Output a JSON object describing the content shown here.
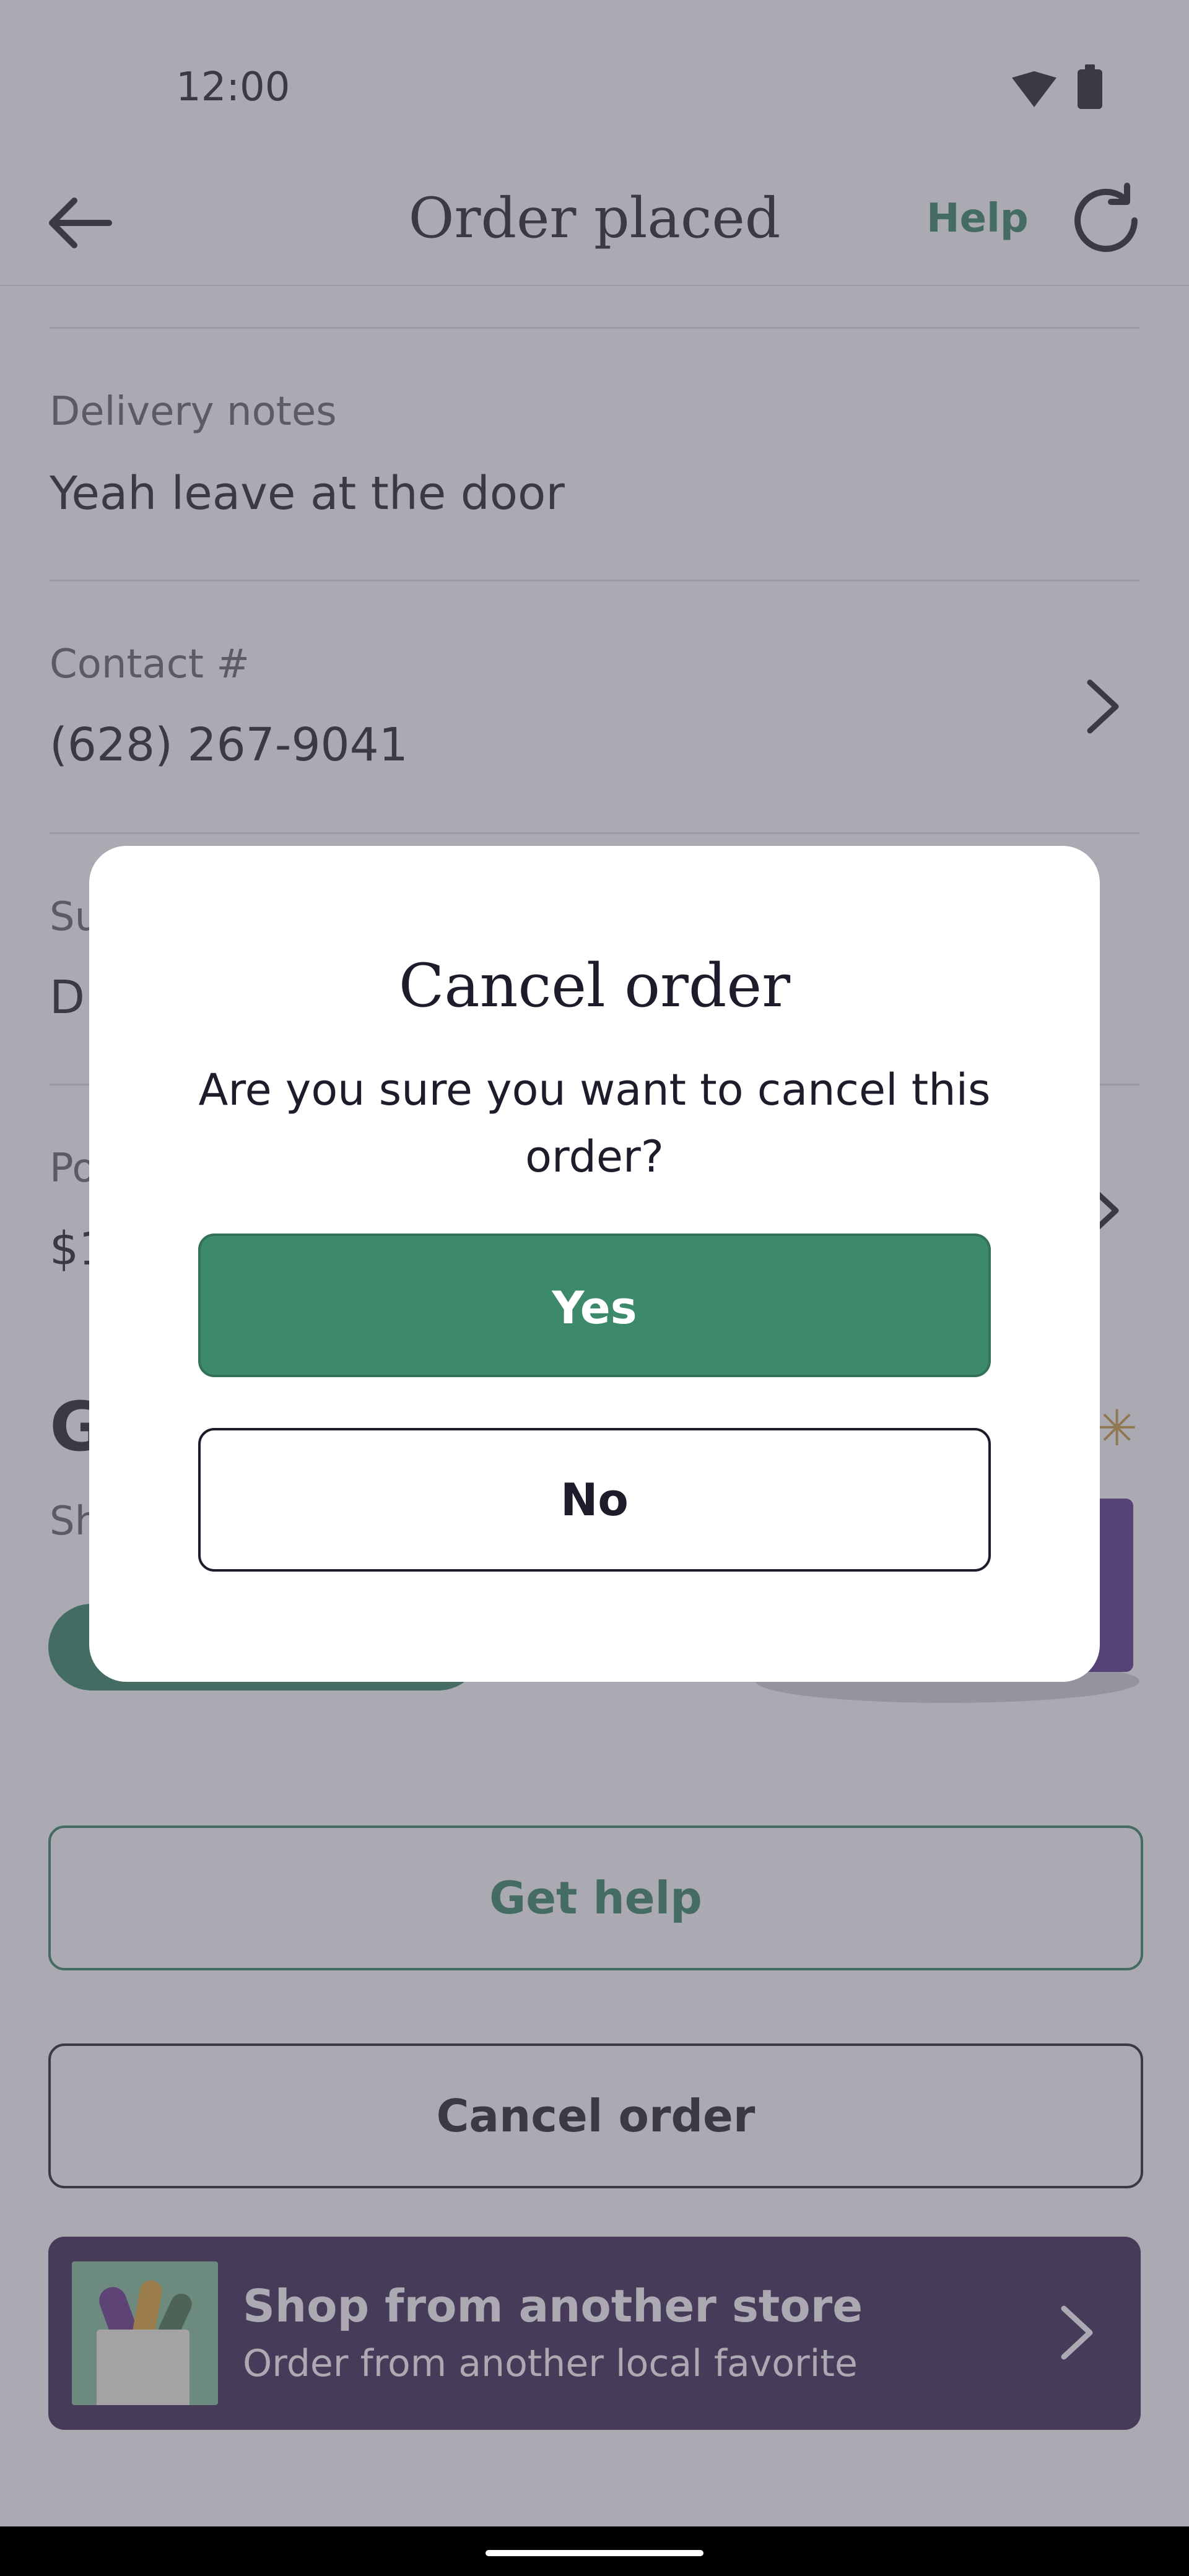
{
  "status_bar": {
    "time": "12:00",
    "icons": [
      "wifi-icon",
      "battery-icon"
    ]
  },
  "header": {
    "title": "Order placed",
    "help_label": "Help",
    "icons": {
      "back": "arrow-left-icon",
      "refresh": "refresh-icon"
    }
  },
  "details": {
    "delivery_notes": {
      "label": "Delivery notes",
      "value": "Yeah leave at the door"
    },
    "contact": {
      "label": "Contact #",
      "value": "(628) 267-9041"
    },
    "subtotal_partial": {
      "label": "Su",
      "value": "D"
    },
    "payment_partial": {
      "label": "Po",
      "value": "$1"
    }
  },
  "promo_section": {
    "heading_partial": "G",
    "sub_partial": "Sh"
  },
  "actions": {
    "get_help": "Get help",
    "cancel_order": "Cancel order"
  },
  "shop_banner": {
    "title": "Shop from another store",
    "subtitle": "Order from another local favorite"
  },
  "dialog": {
    "title": "Cancel order",
    "message": "Are you sure you want to cancel this order?",
    "yes_label": "Yes",
    "no_label": "No"
  },
  "colors": {
    "brand_green": "#3d8a6a",
    "banner_purple": "#3e2d55",
    "text_dark": "#2b2a35"
  }
}
